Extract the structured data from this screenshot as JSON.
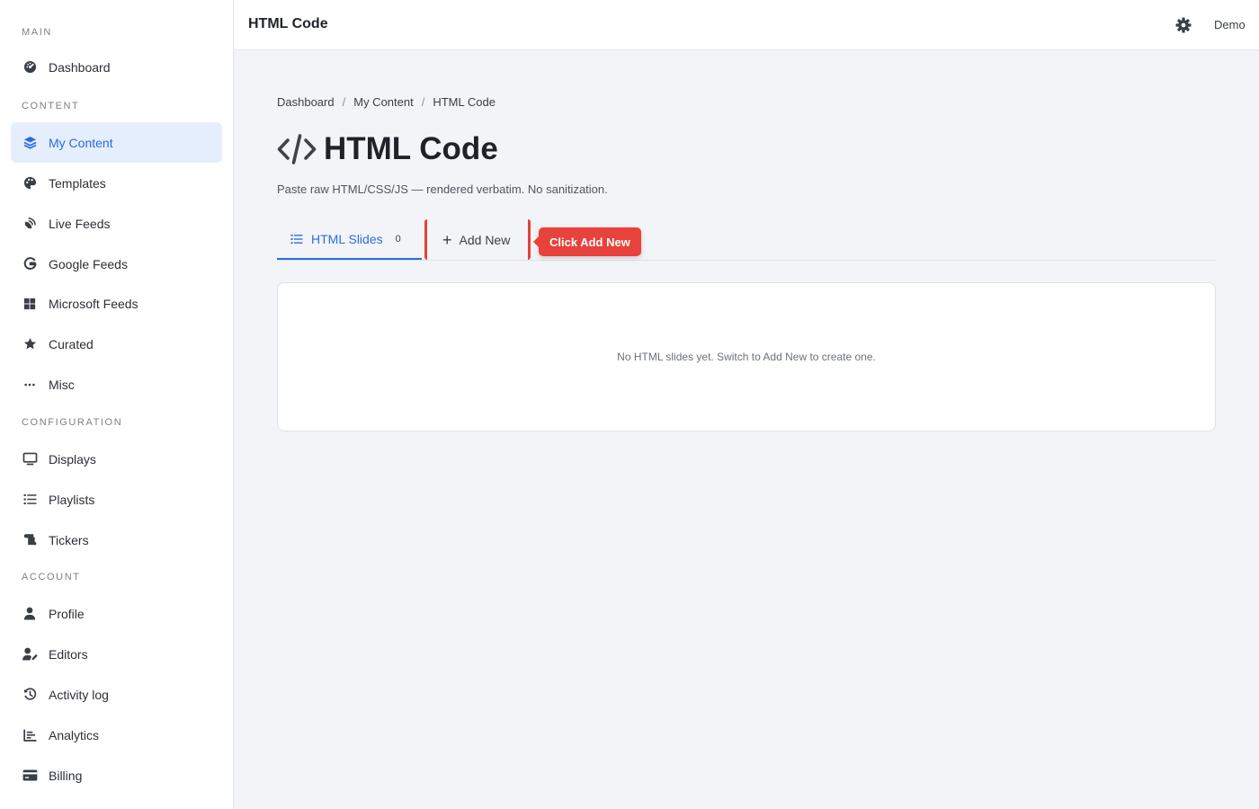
{
  "sidebar": {
    "sections": {
      "main": "MAIN",
      "content": "CONTENT",
      "configuration": "CONFIGURATION",
      "account": "ACCOUNT"
    },
    "items": {
      "dashboard": "Dashboard",
      "my_content": "My Content",
      "templates": "Templates",
      "live_feeds": "Live Feeds",
      "google_feeds": "Google Feeds",
      "microsoft_feeds": "Microsoft Feeds",
      "curated": "Curated",
      "misc": "Misc",
      "displays": "Displays",
      "playlists": "Playlists",
      "tickers": "Tickers",
      "profile": "Profile",
      "editors": "Editors",
      "activity_log": "Activity log",
      "analytics": "Analytics",
      "billing": "Billing"
    },
    "active_item": "my_content"
  },
  "topbar": {
    "title": "HTML Code",
    "settings_icon": "gear-icon",
    "user": "Demo"
  },
  "breadcrumb": {
    "items": [
      "Dashboard",
      "My Content",
      "HTML Code"
    ],
    "separator": "/"
  },
  "page": {
    "icon": "code-icon",
    "title": "HTML Code",
    "description": "Paste raw HTML/CSS/JS — rendered verbatim. No sanitization."
  },
  "tabs": {
    "slides_label": "HTML Slides",
    "slides_count": "0",
    "add_label": "Add New"
  },
  "callout": {
    "text": "Click Add New"
  },
  "empty_state": {
    "text": "No HTML slides yet. Switch to Add New to create one."
  },
  "colors": {
    "accent": "#2c6be0",
    "active_bg": "#e5eefc",
    "callout": "#e8423d"
  }
}
